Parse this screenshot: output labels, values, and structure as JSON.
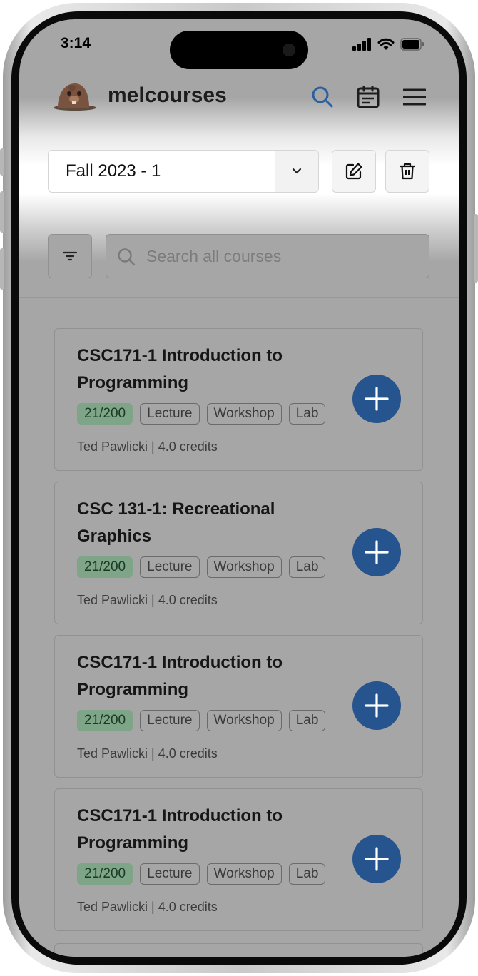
{
  "status_bar": {
    "time": "3:14"
  },
  "header": {
    "brand": "melcourses",
    "icons": {
      "search": "search-icon",
      "calendar": "calendar-icon",
      "menu": "hamburger-menu-icon"
    },
    "accent_color": "#2a5fa0"
  },
  "semester": {
    "selected": "Fall 2023 - 1",
    "edit_icon": "edit-icon",
    "delete_icon": "trash-icon"
  },
  "search": {
    "placeholder": "Search all courses",
    "filter_icon": "filter-icon"
  },
  "courses": [
    {
      "title": "CSC171-1  Introduction to Programming",
      "enrollment": "21/200",
      "tags": [
        "Lecture",
        "Workshop",
        "Lab"
      ],
      "instructor": "Ted Pawlicki",
      "credits": "4.0 credits"
    },
    {
      "title": "CSC 131-1: Recreational Graphics",
      "enrollment": "21/200",
      "tags": [
        "Lecture",
        "Workshop",
        "Lab"
      ],
      "instructor": "Ted Pawlicki",
      "credits": "4.0 credits"
    },
    {
      "title": "CSC171-1  Introduction to Programming",
      "enrollment": "21/200",
      "tags": [
        "Lecture",
        "Workshop",
        "Lab"
      ],
      "instructor": "Ted Pawlicki",
      "credits": "4.0 credits"
    },
    {
      "title": "CSC171-1  Introduction to Programming",
      "enrollment": "21/200",
      "tags": [
        "Lecture",
        "Workshop",
        "Lab"
      ],
      "instructor": "Ted Pawlicki",
      "credits": "4.0 credits"
    }
  ],
  "colors": {
    "add_button": "#25548e",
    "enrollment_badge": "#7fa588",
    "overlay": "#a6a6a6"
  }
}
